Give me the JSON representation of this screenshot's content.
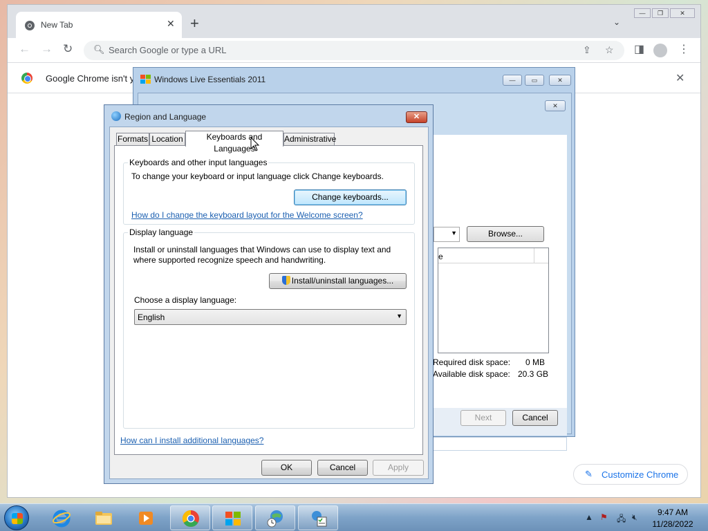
{
  "chrome": {
    "tab_title": "New Tab",
    "omnibox_placeholder": "Search Google or type a URL",
    "infobar_text": "Google Chrome isn't y",
    "customize_label": "Customize Chrome"
  },
  "wle": {
    "title": "Windows Live Essentials 2011",
    "browse_label": "Browse...",
    "list_header_fragment": "e",
    "required_label": "Required disk space:",
    "required_value": "0 MB",
    "available_label": "Available disk space:",
    "available_value": "20.3 GB",
    "next_label": "Next",
    "cancel_label": "Cancel"
  },
  "region": {
    "title": "Region and Language",
    "tabs": [
      "Formats",
      "Location",
      "Keyboards and Languages",
      "Administrative"
    ],
    "active_tab": "Keyboards and Languages",
    "keyboards_group": "Keyboards and other input languages",
    "keyboards_text": "To change your keyboard or input language click Change keyboards.",
    "change_keyboards": "Change keyboards...",
    "welcome_link": "How do I change the keyboard layout for the Welcome screen?",
    "display_group": "Display language",
    "display_text_1": "Install or uninstall languages that Windows can use to display text and",
    "display_text_2": "where supported recognize speech and handwriting.",
    "install_button": "Install/uninstall languages...",
    "choose_label": "Choose a display language:",
    "selected_language": "English",
    "install_link": "How can I install additional languages?",
    "ok": "OK",
    "cancel": "Cancel",
    "apply": "Apply"
  },
  "taskbar": {
    "time": "9:47 AM",
    "date": "11/28/2022",
    "items": [
      "Internet Explorer",
      "Windows Explorer",
      "Media Player",
      "Google Chrome",
      "Windows Live Essentials",
      "Region and Language",
      "Control Panel"
    ]
  },
  "colors": {
    "chrome_link": "#1a73e8",
    "win_link": "#1b5fb0",
    "window_frame": "#c1d6ec"
  }
}
